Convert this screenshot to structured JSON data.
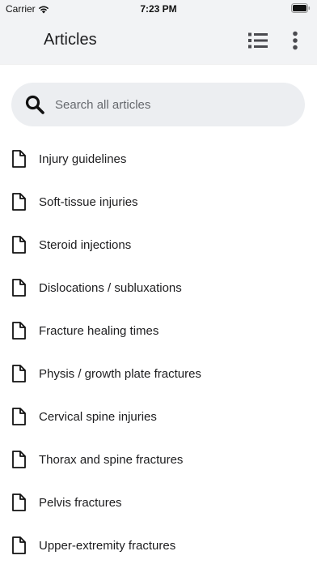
{
  "status_bar": {
    "carrier": "Carrier",
    "time": "7:23 PM"
  },
  "app_bar": {
    "title": "Articles",
    "list_icon": "list-view-icon",
    "more_icon": "more-vertical-icon"
  },
  "search": {
    "placeholder": "Search all articles",
    "icon": "search-icon"
  },
  "articles": [
    {
      "label": "Injury guidelines",
      "icon": "document-icon"
    },
    {
      "label": "Soft-tissue injuries",
      "icon": "document-icon"
    },
    {
      "label": "Steroid injections",
      "icon": "document-icon"
    },
    {
      "label": "Dislocations / subluxations",
      "icon": "document-icon"
    },
    {
      "label": "Fracture healing times",
      "icon": "document-icon"
    },
    {
      "label": "Physis / growth plate fractures",
      "icon": "document-icon"
    },
    {
      "label": "Cervical spine injuries",
      "icon": "document-icon"
    },
    {
      "label": "Thorax and spine fractures",
      "icon": "document-icon"
    },
    {
      "label": "Pelvis fractures",
      "icon": "document-icon"
    },
    {
      "label": "Upper-extremity fractures",
      "icon": "document-icon"
    }
  ],
  "colors": {
    "app_bar_bg": "#f2f3f5",
    "search_bg": "#eceef1",
    "text": "#1d1d1f"
  }
}
